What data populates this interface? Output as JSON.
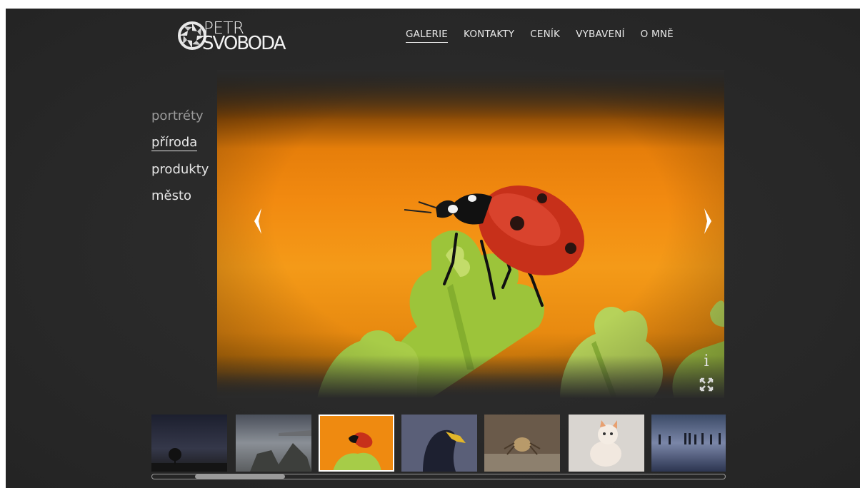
{
  "logo": {
    "line1": "PETR",
    "line2": "SVOBODA"
  },
  "nav": {
    "items": [
      {
        "label": "GALERIE",
        "active": true
      },
      {
        "label": "KONTAKTY",
        "active": false
      },
      {
        "label": "CENÍK",
        "active": false
      },
      {
        "label": "VYBAVENÍ",
        "active": false
      },
      {
        "label": "O MNĚ",
        "active": false
      }
    ]
  },
  "categories": {
    "items": [
      {
        "label": "portréty",
        "state": "dim"
      },
      {
        "label": "příroda",
        "state": "active"
      },
      {
        "label": "produkty",
        "state": "normal"
      },
      {
        "label": "město",
        "state": "normal"
      }
    ]
  },
  "viewer": {
    "info_icon": "i",
    "fullscreen_icon": "fullscreen-icon",
    "prev_icon": "chevron-left-icon",
    "next_icon": "chevron-right-icon"
  },
  "thumbnails": [
    {
      "subject": "tree-night",
      "active": false
    },
    {
      "subject": "rocks-sea",
      "active": false
    },
    {
      "subject": "ladybug",
      "active": true
    },
    {
      "subject": "eagle",
      "active": false
    },
    {
      "subject": "spider",
      "active": false
    },
    {
      "subject": "kitten",
      "active": false
    },
    {
      "subject": "sea-posts",
      "active": false
    }
  ],
  "colors": {
    "background": "#2a2a2a",
    "text": "#e6e6e6",
    "accent_orange": "#f28a10"
  }
}
